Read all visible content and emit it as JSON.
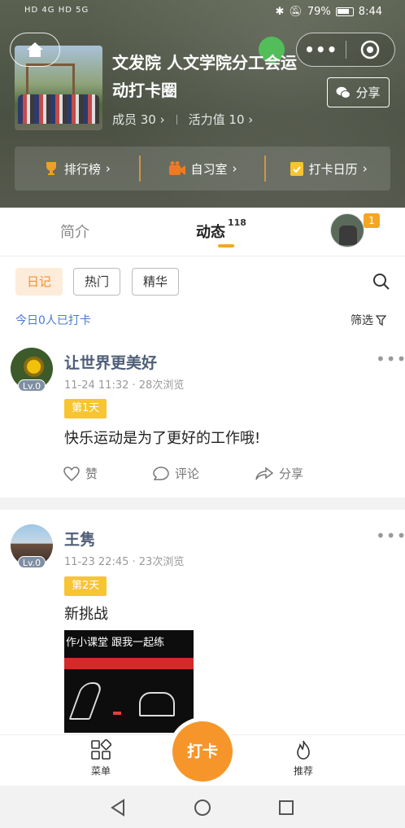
{
  "status_bar": {
    "signal_left": "HD 4G HD 5G",
    "battery": "79%",
    "time": "8:44"
  },
  "header": {
    "title": "文发院 人文学院分工会运动打卡圈",
    "members": "成员 30",
    "activity": "活力值 10",
    "share_label": "分享"
  },
  "quick_links": [
    {
      "label": "排行榜",
      "icon": "trophy-icon"
    },
    {
      "label": "自习室",
      "icon": "camera-icon"
    },
    {
      "label": "打卡日历",
      "icon": "calendar-icon"
    }
  ],
  "tabs": {
    "intro": "简介",
    "feed": "动态",
    "feed_count": "118",
    "avatar_badge": "1"
  },
  "filters": {
    "chips": [
      "日记",
      "热门",
      "精华"
    ],
    "active": "日记"
  },
  "checkin": {
    "today_text": "今日0人已打卡",
    "filter_label": "筛选"
  },
  "posts": [
    {
      "name": "让世界更美好",
      "level": "Lv.0",
      "date": "11-24 11:32",
      "views": "28次浏览",
      "day_tag": "第1天",
      "text": "快乐运动是为了更好的工作哦!",
      "like_label": "赞",
      "comment_label": "评论",
      "share_label": "分享"
    },
    {
      "name": "王隽",
      "level": "Lv.0",
      "date": "11-23 22:45",
      "views": "23次浏览",
      "day_tag": "第2天",
      "text": "新挑战",
      "video_caption": "作小课堂   跟我一起练"
    }
  ],
  "bottom_nav": {
    "menu_label": "菜单",
    "checkin_label": "打卡",
    "recommend_label": "推荐"
  },
  "colors": {
    "accent": "#f6962a",
    "tag_yellow": "#f7c531",
    "link_blue": "#4a7bd0",
    "name_color": "#4f5e78"
  }
}
